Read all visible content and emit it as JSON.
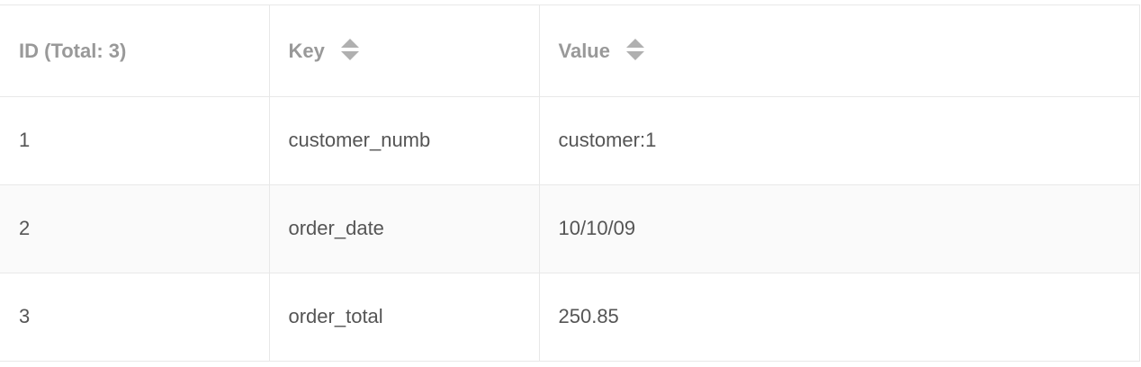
{
  "table": {
    "columns": [
      {
        "label": "ID (Total: 3)",
        "sortable": false,
        "sort_icon": null
      },
      {
        "label": "Key",
        "sortable": true,
        "sort_icon": "sort-up-down-icon"
      },
      {
        "label": "Value",
        "sortable": true,
        "sort_icon": "sort-up-down-icon"
      }
    ],
    "rows": [
      {
        "id": "1",
        "key": "customer_numb",
        "value": "customer:1"
      },
      {
        "id": "2",
        "key": "order_date",
        "value": "10/10/09"
      },
      {
        "id": "3",
        "key": "order_total",
        "value": "250.85"
      }
    ]
  },
  "colors": {
    "border": "#e8e8e8",
    "header_text": "#999999",
    "cell_text": "#555555",
    "stripe": "#fafafa",
    "sort_icon": "#b0b0b0"
  }
}
